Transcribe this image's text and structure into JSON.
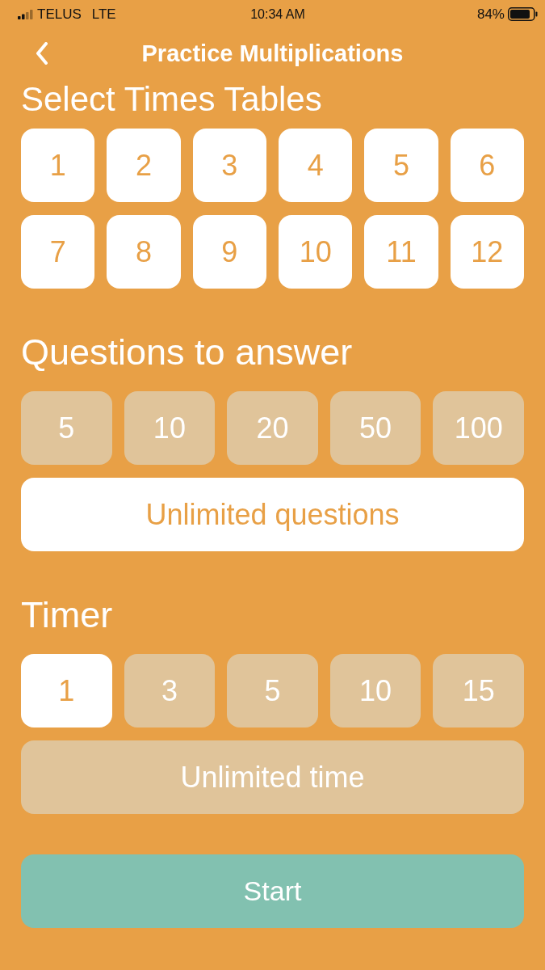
{
  "status_bar": {
    "carrier": "TELUS",
    "network": "LTE",
    "time": "10:34 AM",
    "battery": "84%"
  },
  "nav_bar": {
    "title": "Practice Multiplications"
  },
  "times_tables": {
    "heading": "Select Times Tables",
    "options": [
      {
        "label": "1",
        "selected": true
      },
      {
        "label": "2",
        "selected": true
      },
      {
        "label": "3",
        "selected": true
      },
      {
        "label": "4",
        "selected": true
      },
      {
        "label": "5",
        "selected": true
      },
      {
        "label": "6",
        "selected": true
      },
      {
        "label": "7",
        "selected": true
      },
      {
        "label": "8",
        "selected": true
      },
      {
        "label": "9",
        "selected": true
      },
      {
        "label": "10",
        "selected": true
      },
      {
        "label": "11",
        "selected": true
      },
      {
        "label": "12",
        "selected": true
      }
    ]
  },
  "questions": {
    "heading": "Questions to answer",
    "options": [
      {
        "label": "5",
        "selected": false
      },
      {
        "label": "10",
        "selected": false
      },
      {
        "label": "20",
        "selected": false
      },
      {
        "label": "50",
        "selected": false
      },
      {
        "label": "100",
        "selected": false
      }
    ],
    "unlimited": {
      "label": "Unlimited questions",
      "selected": true
    }
  },
  "timer": {
    "heading": "Timer",
    "options": [
      {
        "label": "1",
        "selected": true
      },
      {
        "label": "3",
        "selected": false
      },
      {
        "label": "5",
        "selected": false
      },
      {
        "label": "10",
        "selected": false
      },
      {
        "label": "15",
        "selected": false
      }
    ],
    "unlimited": {
      "label": "Unlimited time",
      "selected": false
    }
  },
  "start_button": {
    "label": "Start"
  }
}
